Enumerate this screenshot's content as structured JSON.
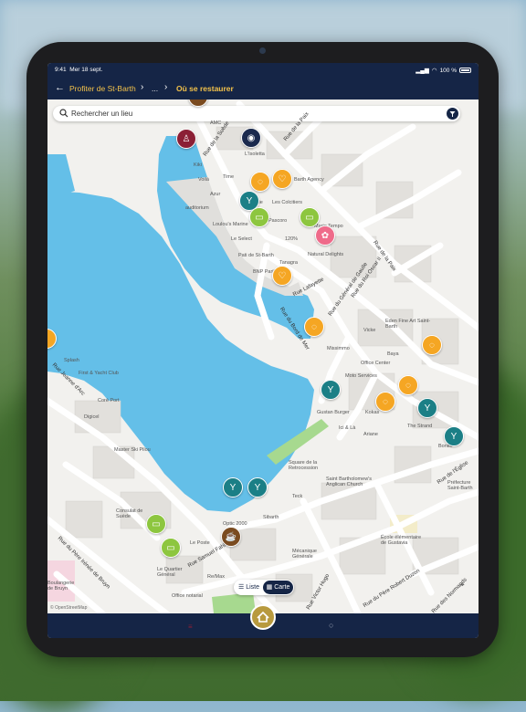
{
  "status": {
    "time": "9:41",
    "date": "Mer 18 sept.",
    "battery": "100 %"
  },
  "nav": {
    "back_icon": "arrow-left-icon",
    "crumb1": "Profiter de St-Barth",
    "crumb2": "...",
    "crumb3": "Où se restaurer"
  },
  "search": {
    "placeholder": "Rechercher un lieu"
  },
  "toggle": {
    "list_label": "Liste",
    "map_label": "Carte"
  },
  "map": {
    "attribution": "© OpenStreetMap",
    "pois": [
      "AMC",
      "L'Isoletta",
      "Kiki",
      "Voilà",
      "Time",
      "Azur",
      "auditorium",
      "Loulou's Marine",
      "Les Colcitiers",
      "Barth Agency",
      "Ilkie",
      "Le Select",
      "Pati de St-Barth",
      "Pascoro",
      "120%",
      "Natural Delights",
      "Marie Tempo",
      "Tanagra",
      "BNP Paribas",
      "Eden Fine Art Saint-Barth",
      "Vicke",
      "Missimmo",
      "Office Center",
      "Baya",
      "Moto Services",
      "Gustan Burger",
      "Kokas",
      "The Strand",
      "Splash",
      "First & Yacht Club",
      "Coré Port",
      "Digicel",
      "Ici & Là",
      "Ariane",
      "Master Ski Pilou",
      "Square de la Retrocession",
      "Saint Bartholomew's Anglican Church",
      "Teck",
      "Sibarth",
      "Consulat de Suède",
      "Le Poste",
      "Optic 2000",
      "Re/Max",
      "Le Quartier Général",
      "Office notarial",
      "Mécanique Générale",
      "École élémentaire de Gustavia",
      "Préfecture Saint-Barth",
      "Boulangerie de Bruyn",
      "Bonito"
    ],
    "streets": [
      "Rue de la Suède",
      "Rue de la Paix",
      "Rue Lafayette",
      "Rue du Bord de Mer",
      "Rue du Général de Gaulle",
      "Rue du Roi Oscar II",
      "Rue de la Paix",
      "Rue Jeanne d'Arc",
      "Rue du Père Irénée de Bruyn",
      "Rue Samuel Fahlberg",
      "Rue Victor Hugo",
      "Rue du Père Robert Duzon",
      "Rue des Normands",
      "Rue de l'Église"
    ]
  }
}
